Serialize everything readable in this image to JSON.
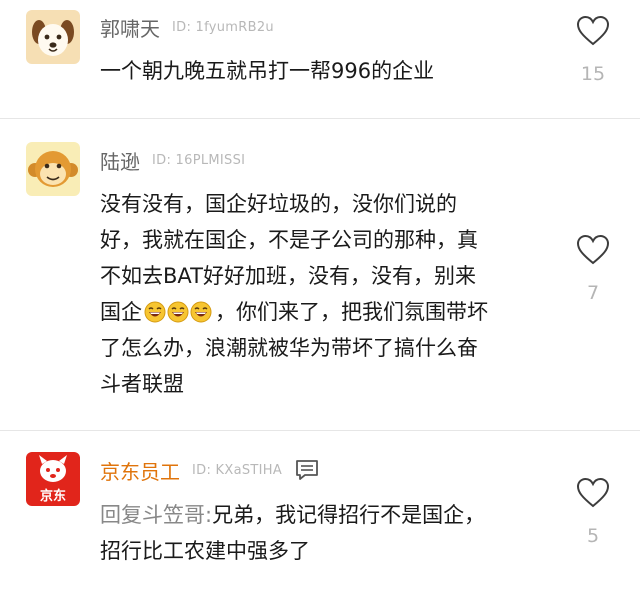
{
  "comments": [
    {
      "username": "郭啸天",
      "uid": "ID: 1fyumRB2u",
      "text": "一个朝九晚五就吊打一帮996的企业",
      "likes": "15",
      "avatar_icon": "dog-face-icon"
    },
    {
      "username": "陆逊",
      "uid": "ID: 16PLMISSI",
      "text_part1": "没有没有，国企好垃圾的，没你们说的\n好，我就在国企，不是子公司的那种，真\n不如去BAT好好加班，没有，没有，别来\n国企",
      "emoji_count": 3,
      "text_part2": "，你们来了，把我们氛围带坏\n了怎么办，浪潮就被华为带坏了搞什么奋\n斗者联盟",
      "likes": "7",
      "avatar_icon": "monkey-face-icon"
    },
    {
      "username": "京东员工",
      "uid": "ID: KXaSTIHA",
      "reply_prefix": "回复斗笠哥:",
      "text": "兄弟，我记得招行不是国企，\n招行比工农建中强多了",
      "likes": "5",
      "avatar_icon": "jd-dog-logo-icon",
      "avatar_logo_text": "京东"
    }
  ],
  "colors": {
    "jd_red": "#e1251b",
    "username_orange": "#e0740b",
    "divider": "#e6e6e6"
  }
}
